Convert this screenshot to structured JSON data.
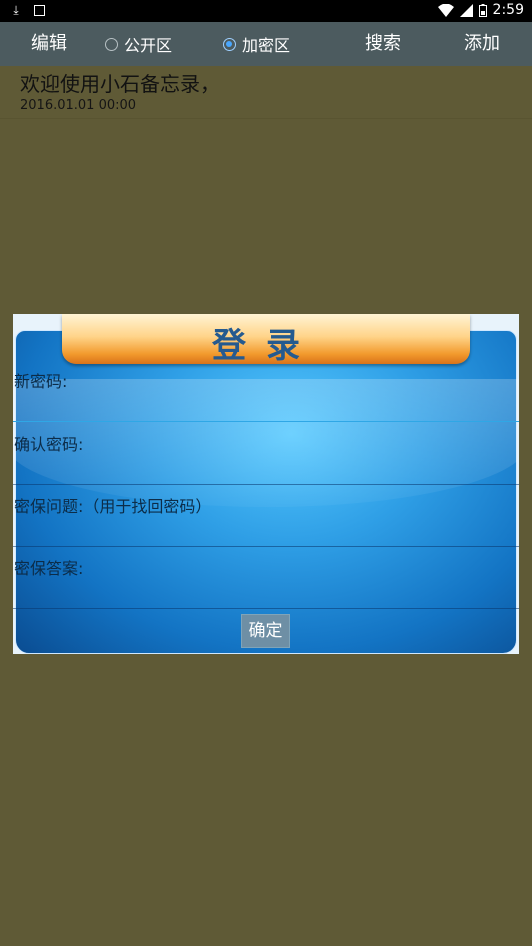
{
  "status_bar": {
    "time": "2:59",
    "icons": [
      "download-icon",
      "image-icon",
      "wifi-icon",
      "signal-icon",
      "battery-icon"
    ]
  },
  "toolbar": {
    "edit": "编辑",
    "public_label": "公开区",
    "private_label": "加密区",
    "search": "搜索",
    "add": "添加",
    "selected": "private"
  },
  "note": {
    "title": "欢迎使用小石备忘录，",
    "date": "2016.01.01 00:00"
  },
  "dialog": {
    "title": "登录",
    "fields": [
      {
        "label": "新密码:"
      },
      {
        "label": "确认密码:"
      },
      {
        "label": "密保问题:（用于找回密码）"
      },
      {
        "label": "密保答案:"
      }
    ],
    "confirm": "确定"
  },
  "colors": {
    "background": "#5f5a36",
    "toolbar": "#4c5b5f",
    "dialog_blue": "#2f9fe6",
    "title_orange": "#f29a2d"
  }
}
